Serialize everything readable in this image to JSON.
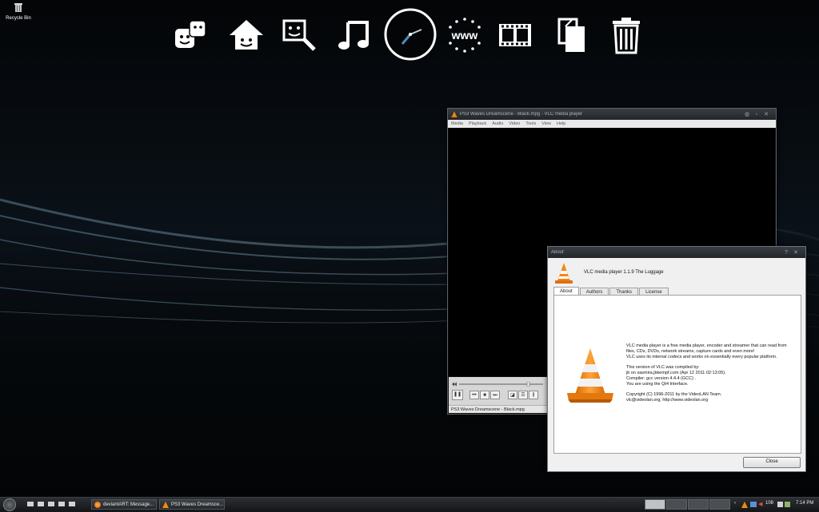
{
  "desktop": {
    "recycle_label": "Recycle Bin"
  },
  "dock": {
    "items": [
      "games-icon",
      "home-icon",
      "photo-icon",
      "music-icon",
      "clock-icon",
      "web-icon",
      "video-icon",
      "documents-icon",
      "trash-icon"
    ],
    "www_label": "www"
  },
  "vlc": {
    "title": "PS3 Waves Dreamscene - Black.mpg - VLC media player",
    "menu": [
      "Media",
      "Playback",
      "Audio",
      "Video",
      "Tools",
      "View",
      "Help"
    ],
    "status": "PS3 Waves Dreamscene - Black.mpg"
  },
  "about": {
    "title": "About",
    "help_btn": "?",
    "heading": "VLC media player 1.1.9 The Luggage",
    "tabs": [
      "About",
      "Authors",
      "Thanks",
      "License"
    ],
    "para1": [
      "VLC media player is a free media player, encoder and streamer that can read from",
      "files, CDs, DVDs, network streams, capture cards and even more!",
      "VLC uses its internal codecs and works on essentially every popular platform."
    ],
    "para2": [
      "This version of VLC was compiled by:",
      " jb on sasmira.jbkempf.com (Apr 12 2011 02:13:05).",
      "Compiler: gcc version 4.4.4 (GCC) .",
      "You are using the Qt4 Interface."
    ],
    "para3": [
      "Copyright (C) 1996-2011 by the VideoLAN Team.",
      "vlc@videolan.org, http://www.videolan.org"
    ],
    "close_label": "Close"
  },
  "taskbar": {
    "tasks": [
      {
        "label": "deviantART: Message..."
      },
      {
        "label": "PS3 Waves Dreamsce..."
      }
    ],
    "tray_number": "108",
    "clock": "7:14 PM"
  }
}
